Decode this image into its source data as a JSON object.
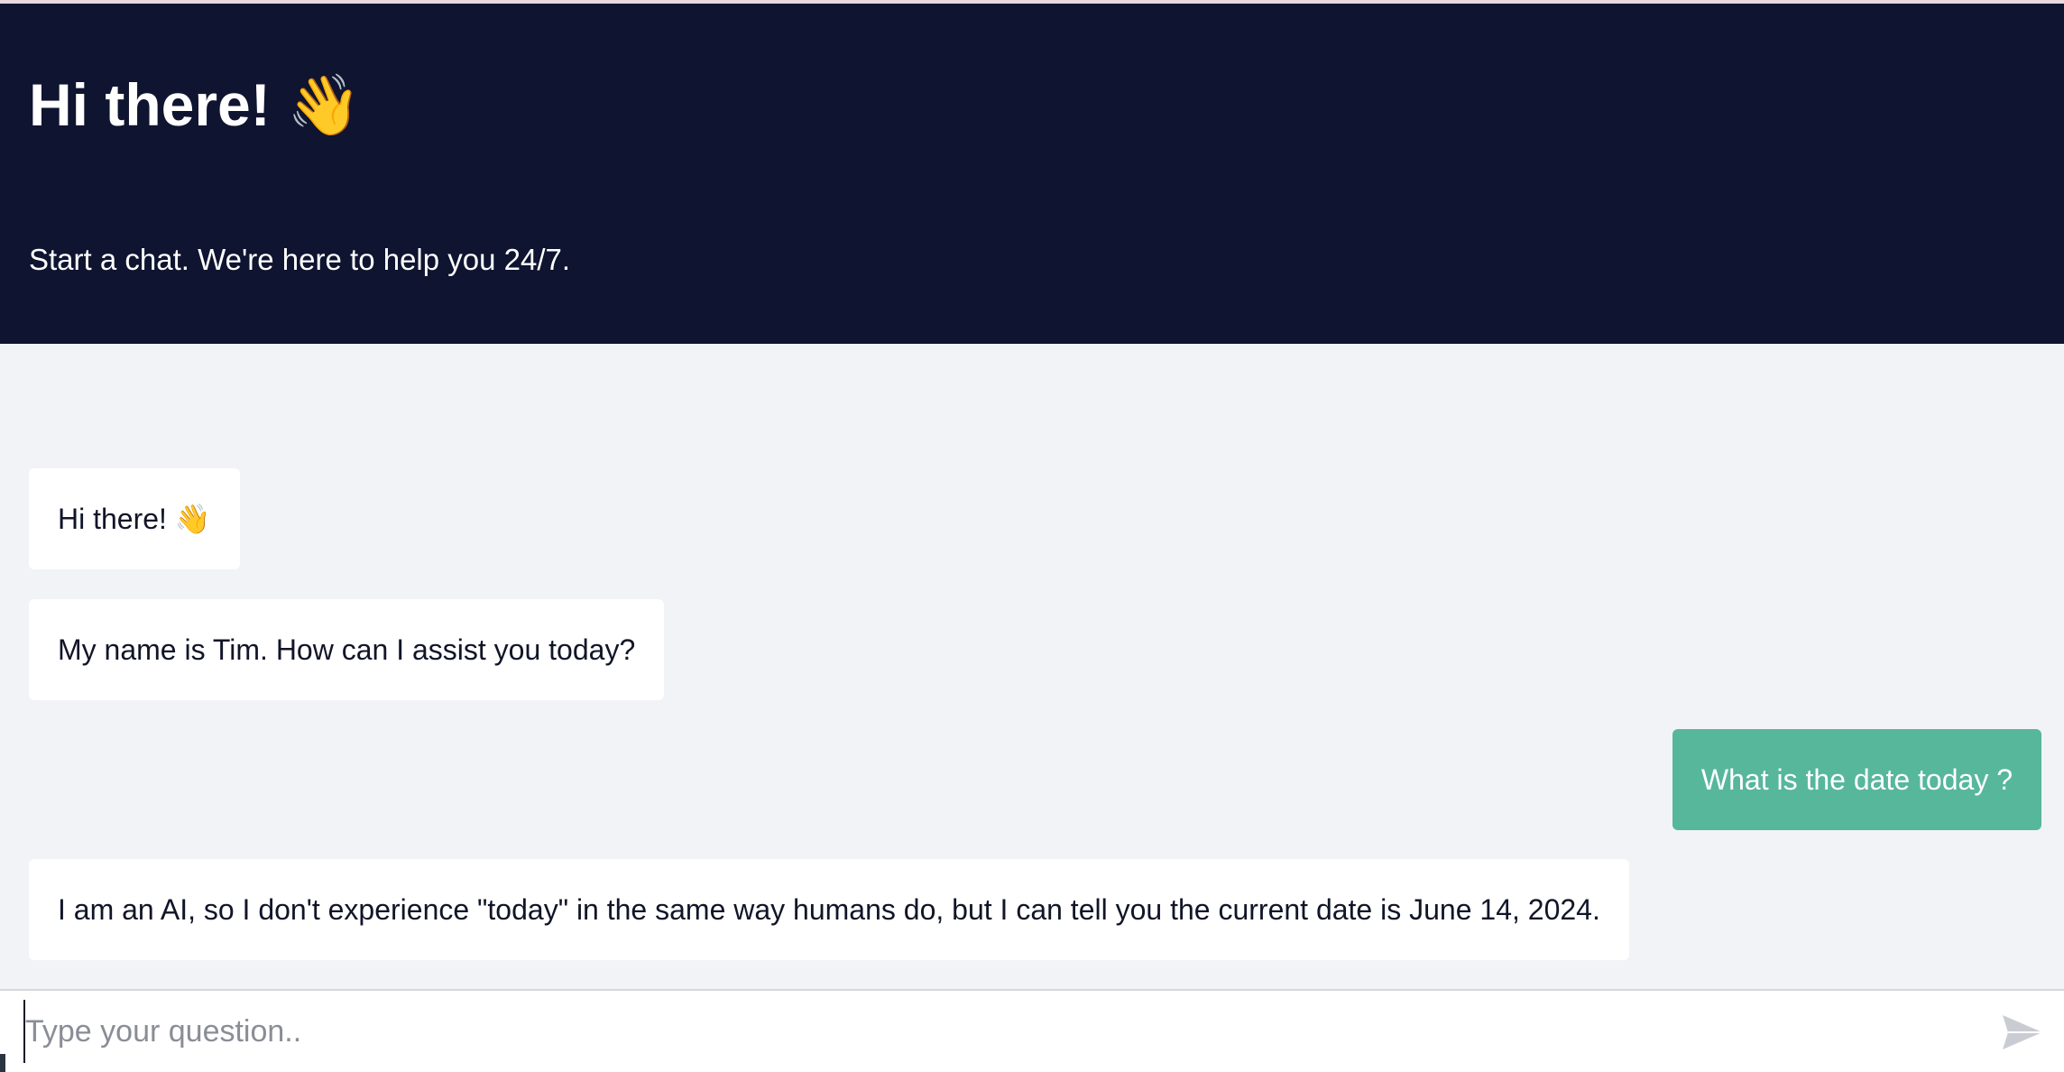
{
  "header": {
    "title": "Hi there! 👋",
    "subtitle": "Start a chat. We're here to help you 24/7."
  },
  "messages": [
    {
      "from": "bot",
      "text": "Hi there! 👋"
    },
    {
      "from": "bot",
      "text": "My name is Tim. How can I assist you today?"
    },
    {
      "from": "user",
      "text": "What is the date today ?"
    },
    {
      "from": "bot",
      "text": "I am an AI, so I don't experience \"today\" in the same way humans do, but I can tell you the current date is June 14, 2024."
    }
  ],
  "composer": {
    "placeholder": "Type your question..",
    "value": "",
    "send_icon": "send-icon"
  },
  "colors": {
    "header_bg": "#0f1430",
    "chat_bg": "#f2f3f7",
    "bot_bubble": "#ffffff",
    "user_bubble": "#57b79b"
  }
}
